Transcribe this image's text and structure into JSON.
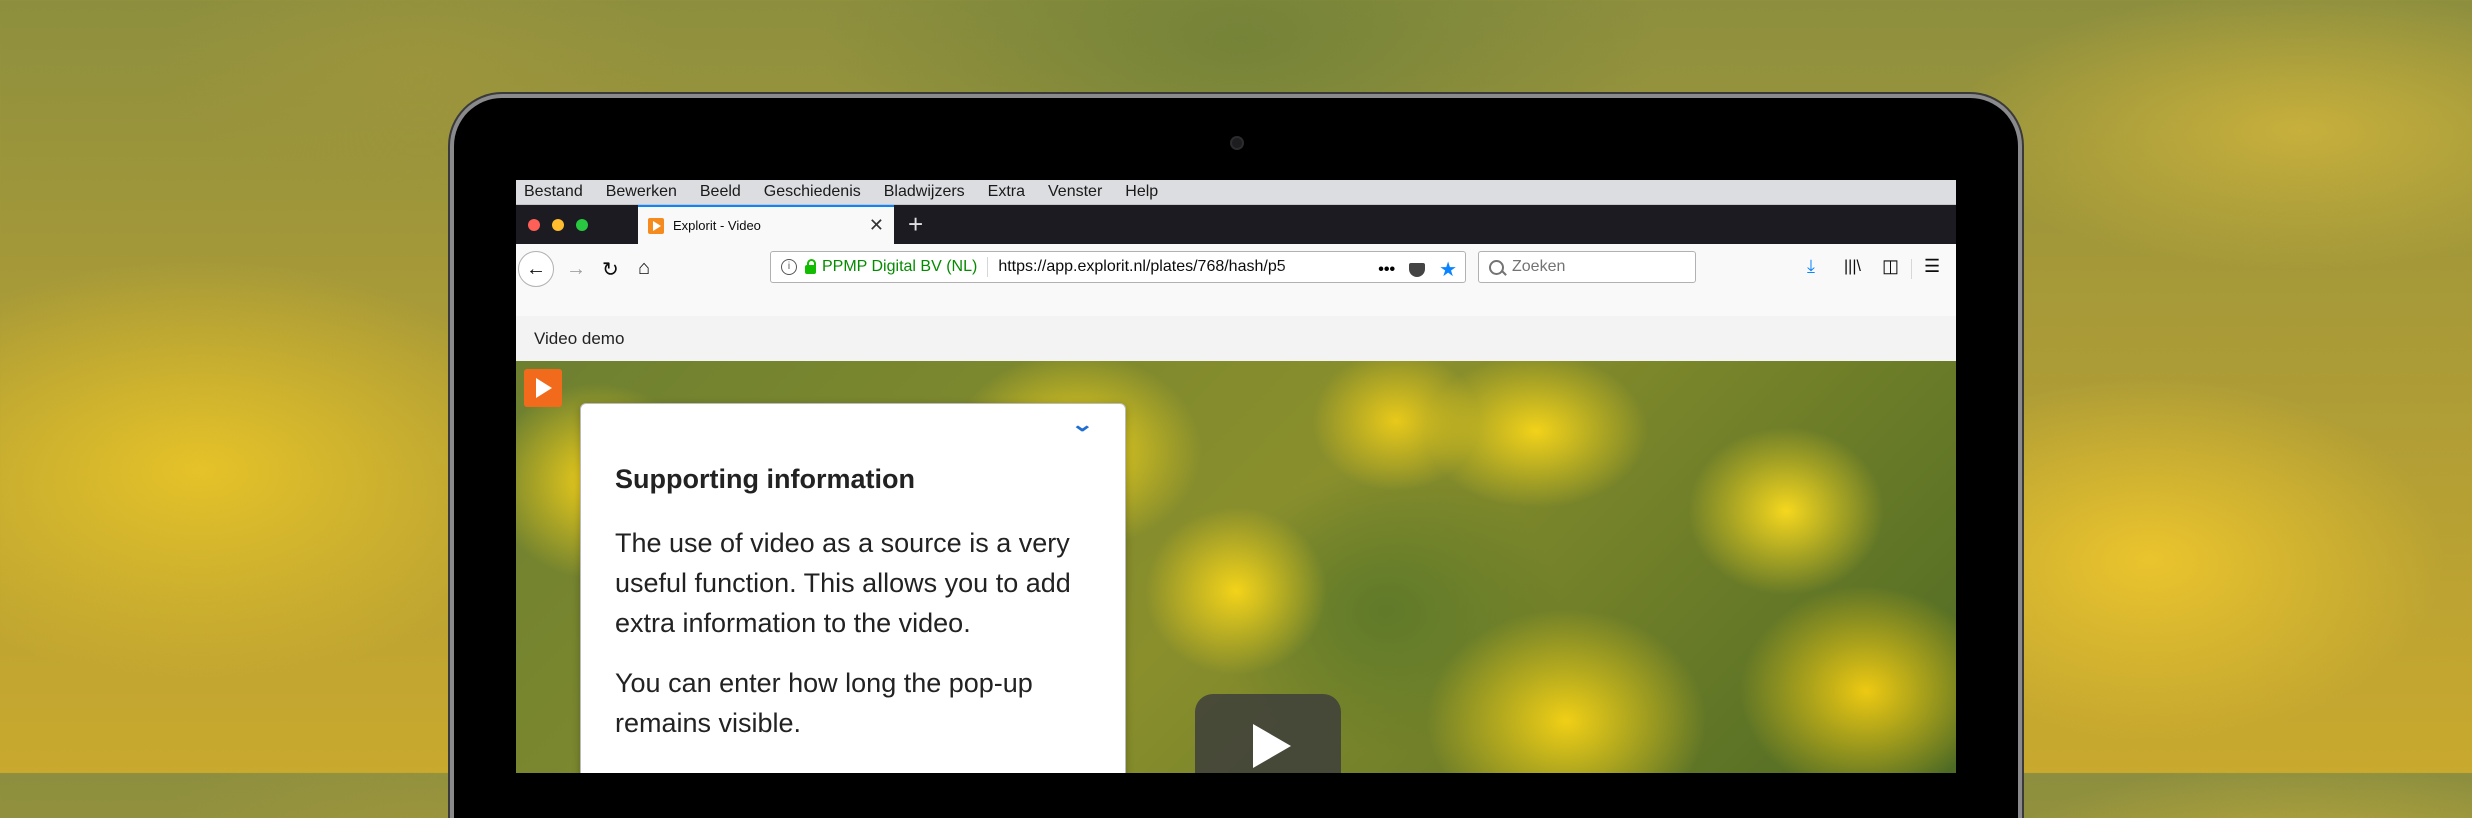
{
  "menubar": {
    "items": [
      "Bestand",
      "Bewerken",
      "Beeld",
      "Geschiedenis",
      "Bladwijzers",
      "Extra",
      "Venster",
      "Help"
    ]
  },
  "tab": {
    "title": "Explorit - Video"
  },
  "urlbar": {
    "identity": "PPMP Digital BV (NL)",
    "url": "https://app.explorit.nl/plates/768/hash/p5"
  },
  "search": {
    "placeholder": "Zoeken"
  },
  "page": {
    "header": "Video demo",
    "popup": {
      "title": "Supporting information",
      "paragraph1": "The use of video as a source is a very useful function. This allows you to add extra information to the video.",
      "paragraph2": "You can enter how long the pop-up remains visible."
    }
  },
  "colors": {
    "accent": "#0a84ff",
    "identity_green": "#058b00",
    "logo_orange": "#f26b1d"
  },
  "icons": [
    "back-arrow-icon",
    "forward-arrow-icon",
    "reload-icon",
    "home-icon",
    "info-icon",
    "lock-icon",
    "more-icon",
    "pocket-icon",
    "bookmark-star-icon",
    "search-icon",
    "download-icon",
    "library-icon",
    "sidebar-icon",
    "hamburger-menu-icon",
    "chevron-down-icon",
    "play-icon"
  ]
}
